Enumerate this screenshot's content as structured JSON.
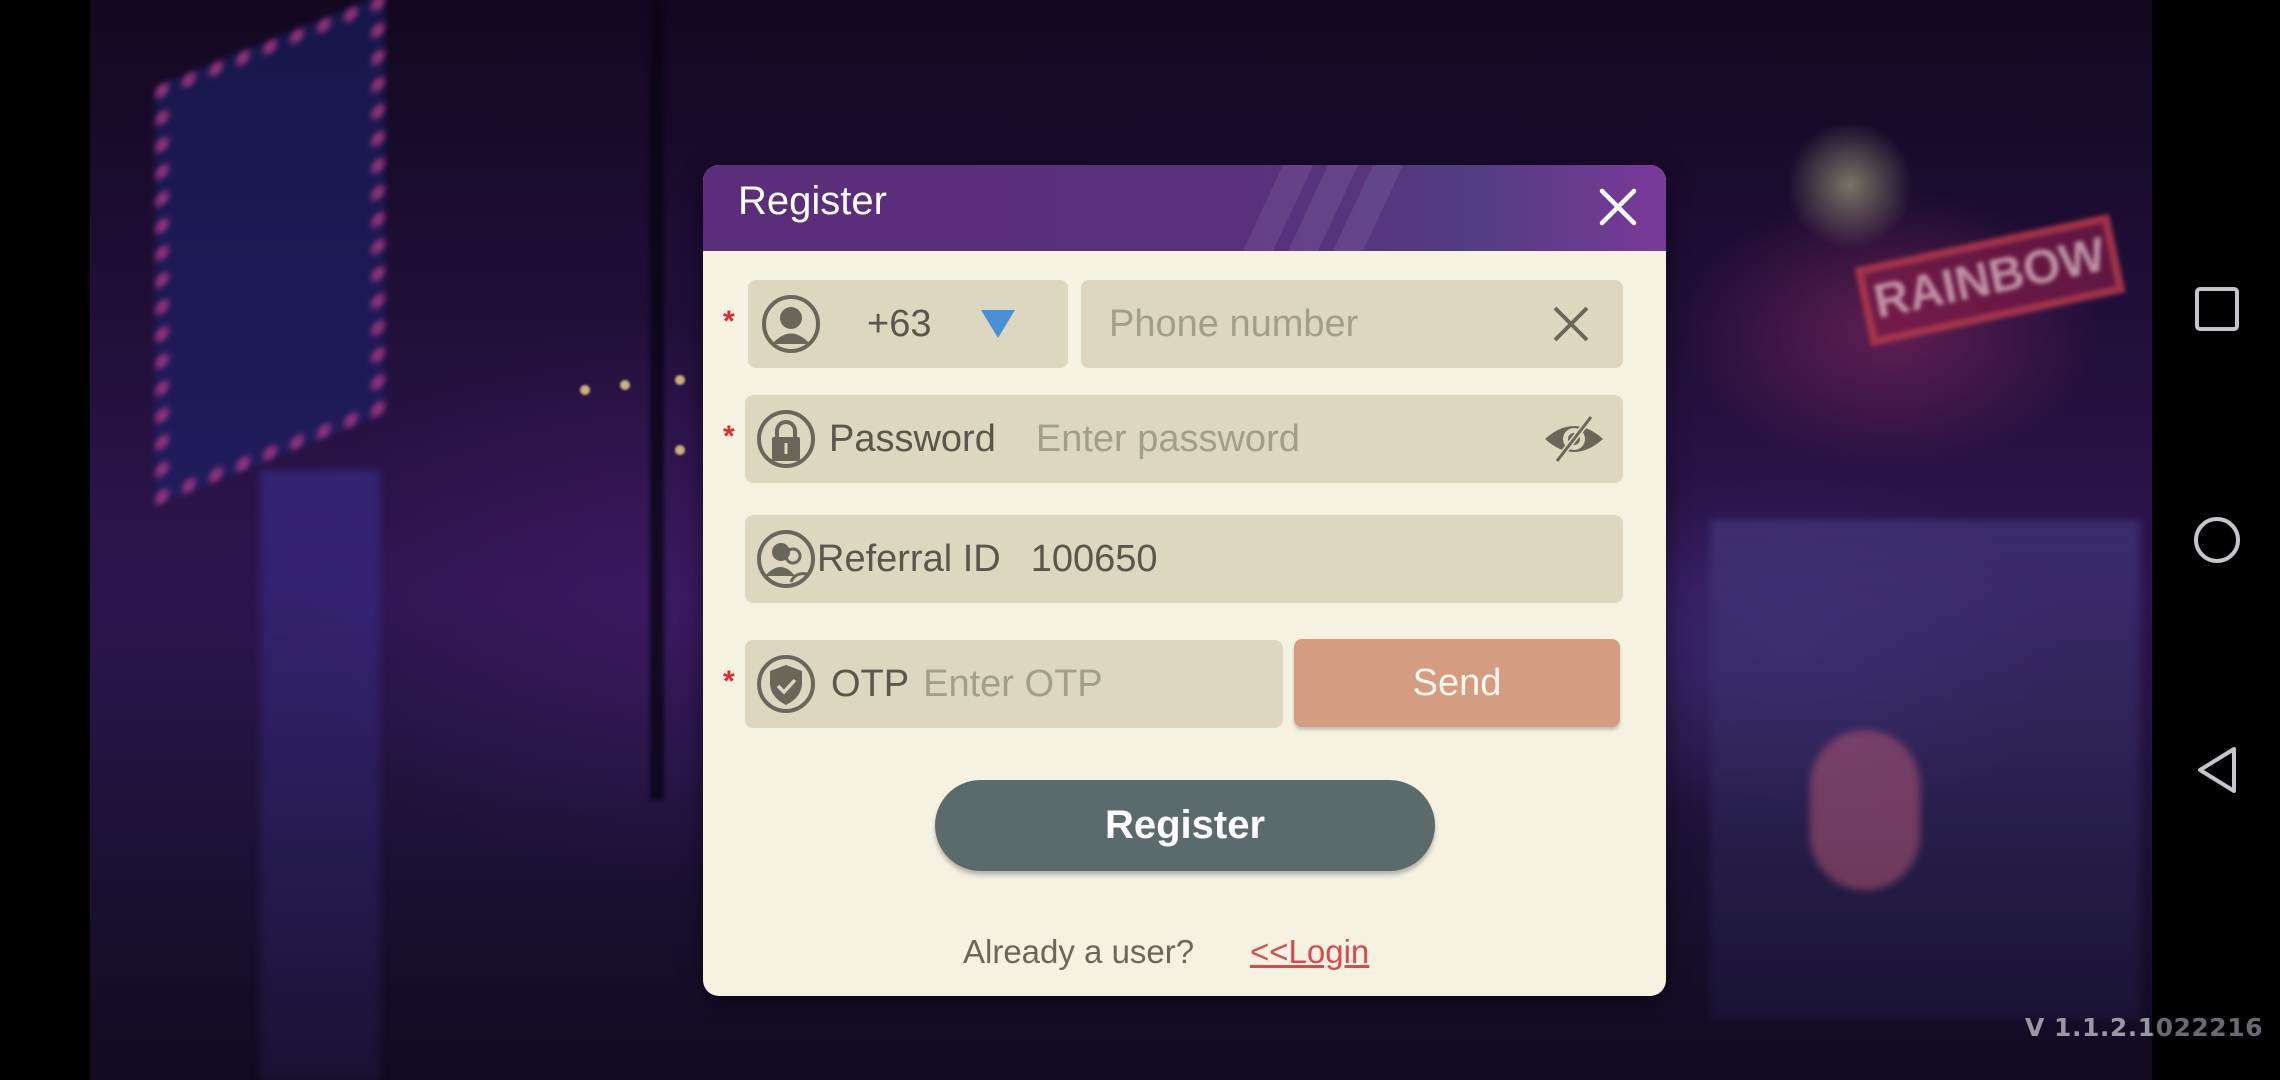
{
  "dialog": {
    "title": "Register",
    "close_icon": "close-icon",
    "phone": {
      "required_mark": "*",
      "country_code": "+63",
      "placeholder": "Phone number",
      "value": ""
    },
    "password": {
      "required_mark": "*",
      "label": "Password",
      "placeholder": "Enter password",
      "value": ""
    },
    "referral": {
      "label": "Referral ID",
      "value": "100650"
    },
    "otp": {
      "required_mark": "*",
      "label": "OTP",
      "placeholder": "Enter OTP",
      "value": "",
      "send_label": "Send"
    },
    "register_label": "Register",
    "footer": {
      "already_text": "Already a user?",
      "login_link": "<<Login"
    }
  },
  "version": "V 1.1.2.1022216",
  "background": {
    "sign_text": "RAINBOW"
  },
  "colors": {
    "header_purple": "#5a2e7a",
    "dialog_bg": "#f5f2e1",
    "field_bg": "#ddd7c0",
    "send_button": "#d49c80",
    "register_button": "#5b6a6b",
    "required": "#e12a2a",
    "link": "#d94a50",
    "dropdown_arrow": "#4a90d9"
  },
  "system_nav": {
    "recents": "square-icon",
    "home": "circle-icon",
    "back": "triangle-back-icon"
  }
}
